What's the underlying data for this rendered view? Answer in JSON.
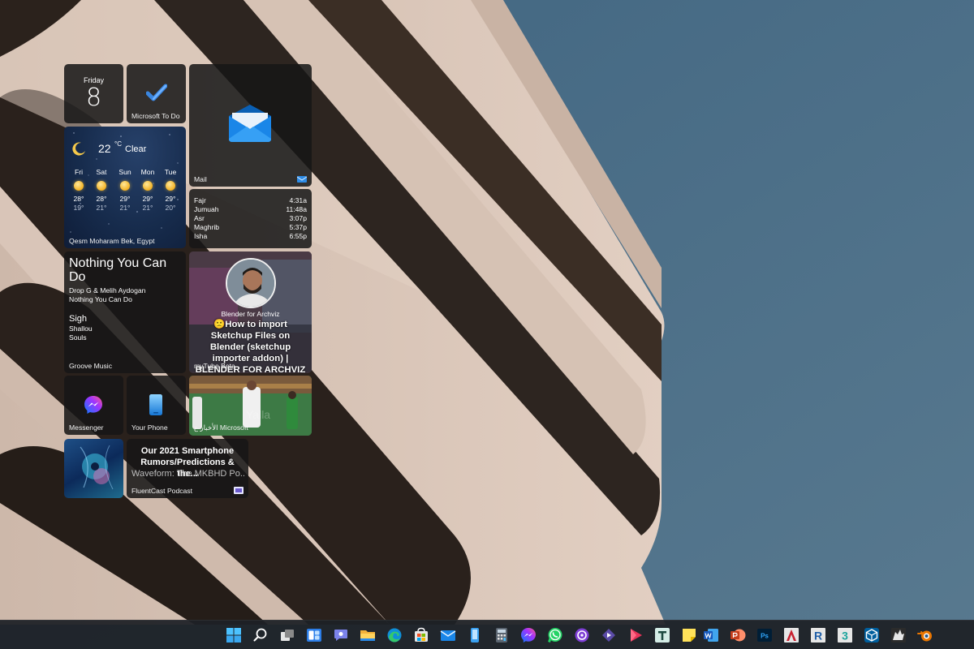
{
  "calendar": {
    "day": "Friday",
    "date": "8"
  },
  "todo": {
    "label": "Microsoft To Do"
  },
  "mail": {
    "label": "Mail"
  },
  "weather": {
    "temp": "22",
    "unit": "°C",
    "condition": "Clear",
    "location": "Qesm Moharam Bek, Egypt",
    "forecast": [
      {
        "day": "Fri",
        "high": "28°",
        "low": "19°"
      },
      {
        "day": "Sat",
        "high": "28°",
        "low": "21°"
      },
      {
        "day": "Sun",
        "high": "29°",
        "low": "21°"
      },
      {
        "day": "Mon",
        "high": "29°",
        "low": "21°"
      },
      {
        "day": "Tue",
        "high": "29°",
        "low": "20°"
      }
    ]
  },
  "prayer": {
    "times": [
      {
        "name": "Fajr",
        "time": "4:31a"
      },
      {
        "name": "Jumuah",
        "time": "11:48a"
      },
      {
        "name": "Asr",
        "time": "3:07p"
      },
      {
        "name": "Maghrib",
        "time": "5:37p"
      },
      {
        "name": "Isha",
        "time": "6:55p"
      }
    ]
  },
  "music": {
    "track": "Nothing You Can Do",
    "artist": "Drop G & Melih Aydogan",
    "album": "Nothing You Can Do",
    "next_title": "Sigh",
    "next_artist": "Shallou",
    "next_album": "Souls",
    "label": "Groove Music"
  },
  "mytube": {
    "channel": "Blender for Archviz",
    "title": "🙁How to import Sketchup Files on Blender (sketchup importer addon) | BLENDER FOR ARCHVIZ",
    "label": "myTube Beta"
  },
  "messenger": {
    "label": "Messenger"
  },
  "yourphone": {
    "label": "Your Phone"
  },
  "news": {
    "label": "الأخبار ع Microsoft"
  },
  "podcast": {
    "title": "Our 2021 Smartphone Rumors/Predictions & the...",
    "subtitle": "Waveform: The MKBHD Po...",
    "label": "FluentCast Podcast"
  },
  "taskbar": {
    "icons": [
      "windows-start-icon",
      "search-icon",
      "task-view-icon",
      "widgets-icon",
      "teams-chat-icon",
      "file-explorer-icon",
      "edge-icon",
      "store-icon",
      "mail-icon",
      "your-phone-icon",
      "calculator-icon",
      "messenger-icon",
      "whatsapp-icon",
      "media-player-icon",
      "vlc-icon",
      "play-icon",
      "typora-icon",
      "sticky-notes-icon",
      "word-icon",
      "powerpoint-icon",
      "photoshop-icon",
      "autocad-icon",
      "revit-icon",
      "3dsmax-icon",
      "sketchup-icon",
      "rhino-icon",
      "blender-icon"
    ]
  },
  "colors": {
    "accent": "#0078d4",
    "sky": "#4b6e87",
    "tile": "#161616"
  }
}
